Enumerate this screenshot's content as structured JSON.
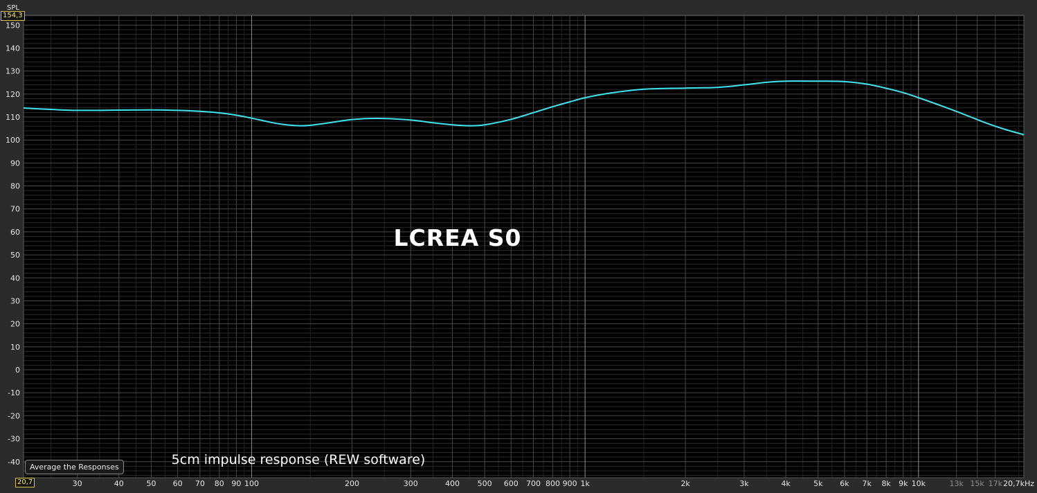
{
  "chart_data": {
    "type": "line",
    "title": "LCREA S0",
    "subtitle": "5cm impulse response (REW software)",
    "ylabel": "SPL",
    "xlabel": "",
    "x_scale": "log",
    "x_unit": "Hz",
    "xlim": [
      20.7,
      20700
    ],
    "ylim": [
      -47,
      154.3
    ],
    "range_labels": {
      "x_min": "20,7",
      "x_max": "20,7kHz",
      "y_max": "154,3"
    },
    "grid": true,
    "x_ticks": [
      {
        "value": 30,
        "label": "30"
      },
      {
        "value": 40,
        "label": "40"
      },
      {
        "value": 50,
        "label": "50"
      },
      {
        "value": 60,
        "label": "60"
      },
      {
        "value": 70,
        "label": "70"
      },
      {
        "value": 80,
        "label": "80"
      },
      {
        "value": 90,
        "label": "90"
      },
      {
        "value": 100,
        "label": "100"
      },
      {
        "value": 200,
        "label": "200"
      },
      {
        "value": 300,
        "label": "300"
      },
      {
        "value": 400,
        "label": "400"
      },
      {
        "value": 500,
        "label": "500"
      },
      {
        "value": 600,
        "label": "600"
      },
      {
        "value": 700,
        "label": "700"
      },
      {
        "value": 800,
        "label": "800"
      },
      {
        "value": 900,
        "label": "900"
      },
      {
        "value": 1000,
        "label": "1k"
      },
      {
        "value": 2000,
        "label": "2k"
      },
      {
        "value": 3000,
        "label": "3k"
      },
      {
        "value": 4000,
        "label": "4k"
      },
      {
        "value": 5000,
        "label": "5k"
      },
      {
        "value": 6000,
        "label": "6k"
      },
      {
        "value": 7000,
        "label": "7k"
      },
      {
        "value": 8000,
        "label": "8k"
      },
      {
        "value": 9000,
        "label": "9k"
      },
      {
        "value": 10000,
        "label": "10k"
      },
      {
        "value": 13000,
        "label": "13k",
        "dim": true
      },
      {
        "value": 15000,
        "label": "15k",
        "dim": true
      },
      {
        "value": 17000,
        "label": "17k",
        "dim": true
      }
    ],
    "y_ticks": [
      150,
      140,
      130,
      120,
      110,
      100,
      90,
      80,
      70,
      60,
      50,
      40,
      30,
      20,
      10,
      0,
      -10,
      -20,
      -30,
      -40
    ],
    "series": [
      {
        "color": "#3ee6f0",
        "x": [
          20.7,
          25,
          30,
          40,
          50,
          60,
          70,
          80,
          90,
          100,
          120,
          140,
          160,
          200,
          240,
          300,
          350,
          400,
          450,
          500,
          600,
          700,
          800,
          900,
          1000,
          1200,
          1500,
          2000,
          2500,
          3000,
          3500,
          4000,
          5000,
          6000,
          7000,
          8000,
          9000,
          10000,
          12000,
          14000,
          16000,
          18000,
          20700
        ],
        "y": [
          113.9,
          113.3,
          112.9,
          113.0,
          113.1,
          112.9,
          112.5,
          111.8,
          110.8,
          109.5,
          107.1,
          106.2,
          106.9,
          108.9,
          109.4,
          108.7,
          107.5,
          106.6,
          106.2,
          106.6,
          109.0,
          111.9,
          114.5,
          116.6,
          118.4,
          120.5,
          122.1,
          122.6,
          122.9,
          124.0,
          125.1,
          125.6,
          125.6,
          125.4,
          124.3,
          122.5,
          120.6,
          118.4,
          114.3,
          110.6,
          107.3,
          104.8,
          102.3
        ]
      }
    ]
  },
  "controls": {
    "average_button": "Average the Responses"
  }
}
